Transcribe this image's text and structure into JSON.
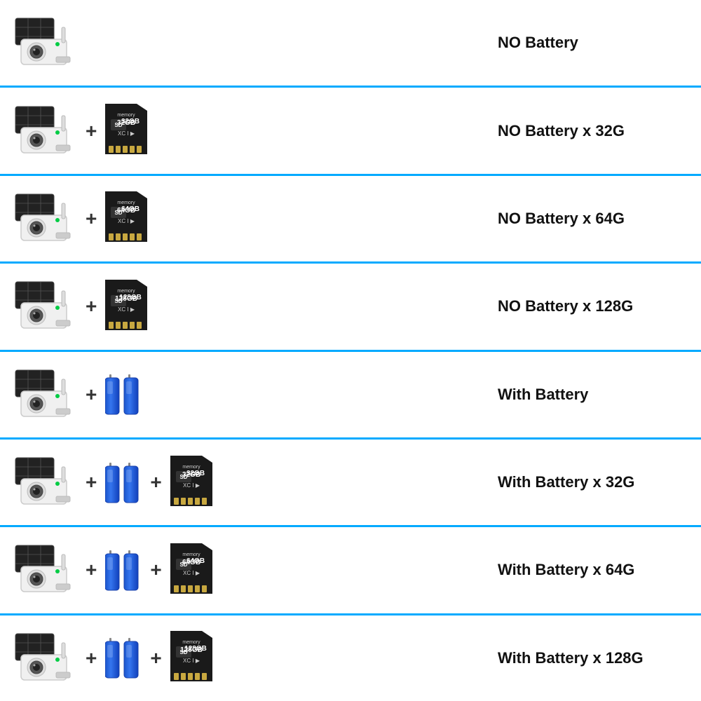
{
  "rows": [
    {
      "id": "row-1",
      "label": "NO Battery",
      "has_battery": false,
      "sd_size": null
    },
    {
      "id": "row-2",
      "label": "NO Battery x 32G",
      "has_battery": false,
      "sd_size": "32GB"
    },
    {
      "id": "row-3",
      "label": "NO Battery x 64G",
      "has_battery": false,
      "sd_size": "64GB"
    },
    {
      "id": "row-4",
      "label": "NO Battery x 128G",
      "has_battery": false,
      "sd_size": "128GB"
    },
    {
      "id": "row-5",
      "label": "With Battery",
      "has_battery": true,
      "sd_size": null
    },
    {
      "id": "row-6",
      "label": "With Battery x 32G",
      "has_battery": true,
      "sd_size": "32GB"
    },
    {
      "id": "row-7",
      "label": "With Battery x 64G",
      "has_battery": true,
      "sd_size": "64GB"
    },
    {
      "id": "row-8",
      "label": "With Battery x 128G",
      "has_battery": true,
      "sd_size": "128GB"
    }
  ],
  "plus_sign": "+"
}
